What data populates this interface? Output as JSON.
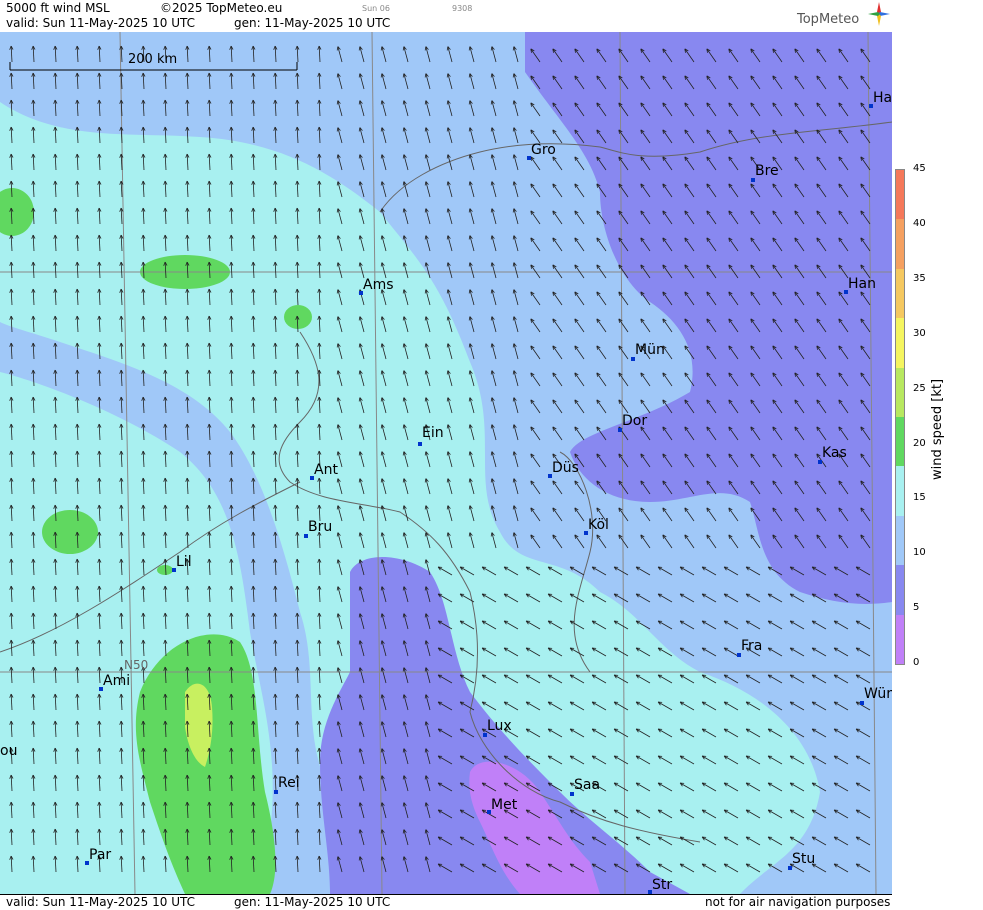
{
  "header": {
    "title": "5000 ft wind MSL",
    "copyright": "©2025 TopMeteo.eu",
    "day_label": "Sun 06",
    "code": "9308",
    "valid": "valid:  Sun  11-May-2025  10 UTC",
    "gen": "gen: 11-May-2025 10 UTC",
    "logo": "TopMeteo"
  },
  "footer": {
    "valid": "valid:  Sun  11-May-2025  10 UTC",
    "gen": "gen: 11-May-2025 10 UTC",
    "disclaimer": "not for air navigation purposes"
  },
  "map": {
    "scale_label": "200 km",
    "lat_label": "N50",
    "cities": [
      {
        "name": "Ha",
        "id": "ham"
      },
      {
        "name": "Gro",
        "id": "gro"
      },
      {
        "name": "Bre",
        "id": "bre"
      },
      {
        "name": "Ams",
        "id": "ams"
      },
      {
        "name": "Han",
        "id": "han"
      },
      {
        "name": "Mün",
        "id": "mun"
      },
      {
        "name": "Ein",
        "id": "ein"
      },
      {
        "name": "Dor",
        "id": "dor"
      },
      {
        "name": "Kas",
        "id": "kas"
      },
      {
        "name": "Ant",
        "id": "ant"
      },
      {
        "name": "Düs",
        "id": "dus"
      },
      {
        "name": "Bru",
        "id": "bru"
      },
      {
        "name": "Köl",
        "id": "kol"
      },
      {
        "name": "Lil",
        "id": "lil"
      },
      {
        "name": "Fra",
        "id": "fra"
      },
      {
        "name": "Ami",
        "id": "ami"
      },
      {
        "name": "Wür",
        "id": "wur"
      },
      {
        "name": "Lux",
        "id": "lux"
      },
      {
        "name": "ou",
        "id": "rou"
      },
      {
        "name": "Rei",
        "id": "rei"
      },
      {
        "name": "Saa",
        "id": "saa"
      },
      {
        "name": "Met",
        "id": "met"
      },
      {
        "name": "Par",
        "id": "par"
      },
      {
        "name": "Stu",
        "id": "stu"
      },
      {
        "name": "Str",
        "id": "str"
      }
    ]
  },
  "legend": {
    "title": "wind  speed  [kt]",
    "ticks": [
      "45",
      "40",
      "35",
      "30",
      "25",
      "20",
      "15",
      "10",
      "5",
      "0"
    ],
    "colors": [
      "#f5785a",
      "#f5a060",
      "#f5c860",
      "#f5f560",
      "#b8e860",
      "#60d860",
      "#a8f0f0",
      "#a0c8f8",
      "#8888f0",
      "#c080f8"
    ]
  },
  "colors": {
    "calm_violet": "#c080f8",
    "light_purple": "#8888f0",
    "light_blue": "#a0c8f8",
    "cyan": "#a8f0f0",
    "green": "#60d860",
    "yellow_green": "#c8f060"
  }
}
